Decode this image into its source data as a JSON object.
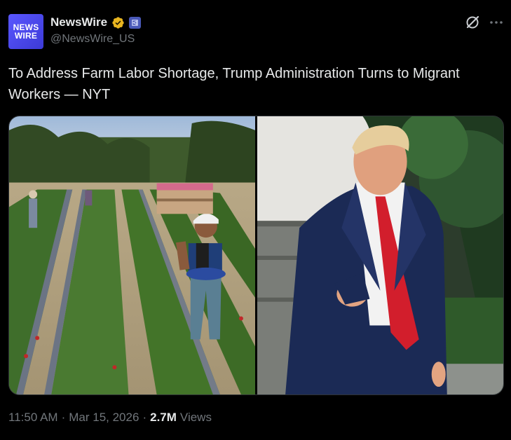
{
  "author": {
    "avatar_line1": "NEWS",
    "avatar_line2": "WIRE",
    "display_name": "NewsWire",
    "handle": "@NewsWire_US",
    "verified_badge_color": "#e8b520",
    "affiliate_badge_color": "#4a59b8"
  },
  "tweet": {
    "text": "To Address Farm Labor Shortage, Trump Administration Turns to Migrant Workers — NYT"
  },
  "media": {
    "left_image_subject": "farm workers in strawberry field",
    "right_image_subject": "man in navy suit and red tie outdoors"
  },
  "meta": {
    "time": "11:50 AM",
    "separator1": "·",
    "date": "Mar 15, 2026",
    "separator2": "·",
    "views_count": "2.7M",
    "views_label": "Views"
  },
  "colors": {
    "background": "#000000",
    "text_primary": "#e7e9ea",
    "text_secondary": "#71767b",
    "border": "#2f3336"
  },
  "icons": [
    "grok-icon",
    "more-icon",
    "verified-badge-icon",
    "affiliate-badge-icon"
  ]
}
